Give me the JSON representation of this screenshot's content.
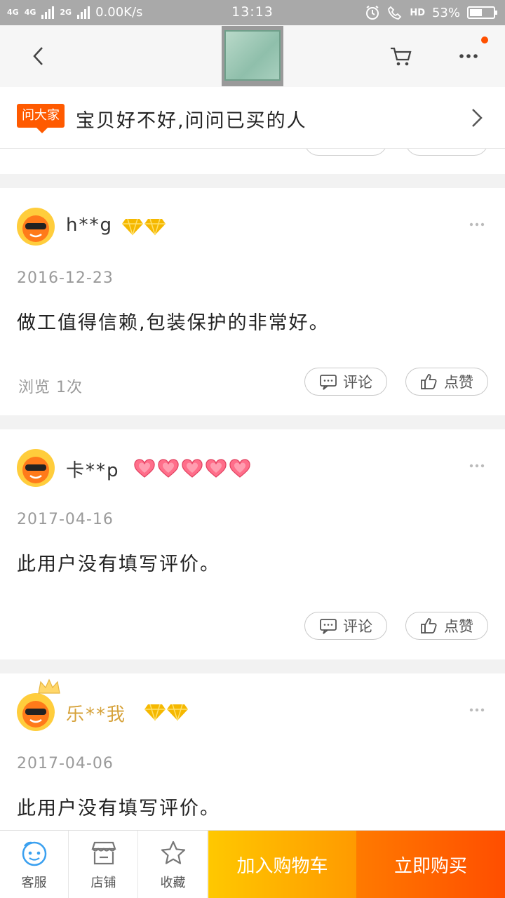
{
  "status_bar": {
    "network_1": "4G",
    "network_2": "4G",
    "network_3": "2G",
    "speed": "0.00K/s",
    "time": "13:13",
    "hd": "HD",
    "battery": "53%",
    "battery_level": 0.53
  },
  "top_nav": {
    "icons": [
      "back-arrow-icon",
      "product-thumbnail",
      "cart-icon",
      "more-icon"
    ],
    "notification_dot_color": "#ff5000"
  },
  "ask_banner": {
    "badge": "问大家",
    "text": "宝贝好不好,问问已买的人"
  },
  "reviews": [
    {
      "username": "h**g",
      "level_badge": "gold-diamond",
      "badge_count": 2,
      "date": "2016-12-23",
      "content": "做工值得信赖,包装保护的非常好。",
      "views": "浏览 1次",
      "comment_label": "评论",
      "like_label": "点赞"
    },
    {
      "username": "卡**p",
      "level_badge": "red-heart",
      "badge_count": 5,
      "date": "2017-04-16",
      "content": "此用户没有填写评价。",
      "comment_label": "评论",
      "like_label": "点赞"
    },
    {
      "username": "乐**我",
      "level_badge": "gold-diamond",
      "badge_count": 2,
      "date": "2017-04-06",
      "content": "此用户没有填写评价。"
    }
  ],
  "bottom_bar": {
    "service": "客服",
    "shop": "店铺",
    "favorite": "收藏",
    "add_to_cart": "加入购物车",
    "buy_now": "立即购买"
  },
  "colors": {
    "accent": "#ff5000",
    "add_to_cart_gradient": [
      "#ffc800",
      "#ff9a00"
    ],
    "buy_now_gradient": [
      "#ff7a00",
      "#ff4e00"
    ],
    "vip_name": "#d6a23a"
  }
}
